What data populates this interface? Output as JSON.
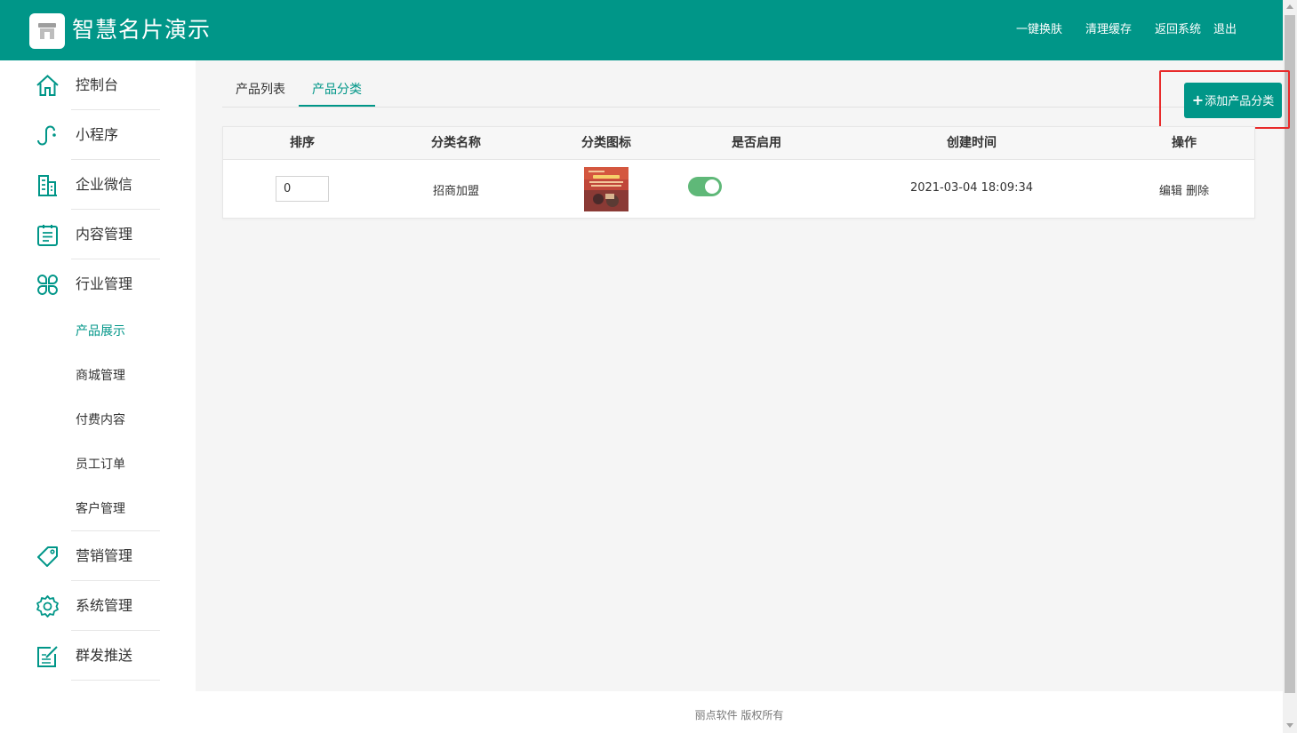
{
  "header": {
    "brand": "智慧名片演示",
    "nav": [
      "一键换肤",
      "清理缓存",
      "返回系统",
      "退出"
    ]
  },
  "sidebar": {
    "items": [
      {
        "label": "控制台",
        "icon": "home-icon"
      },
      {
        "label": "小程序",
        "icon": "mini-program-icon"
      },
      {
        "label": "企业微信",
        "icon": "building-icon"
      },
      {
        "label": "内容管理",
        "icon": "clipboard-icon"
      },
      {
        "label": "行业管理",
        "icon": "grid-icon"
      },
      {
        "label": "营销管理",
        "icon": "tag-icon"
      },
      {
        "label": "系统管理",
        "icon": "gear-icon"
      },
      {
        "label": "群发推送",
        "icon": "edit-icon"
      }
    ],
    "sub_items": [
      "产品展示",
      "商城管理",
      "付费内容",
      "员工订单",
      "客户管理"
    ],
    "active_sub": "产品展示"
  },
  "tabs": {
    "items": [
      "产品列表",
      "产品分类"
    ],
    "active": "产品分类"
  },
  "toolbar": {
    "add_label": "添加产品分类"
  },
  "table": {
    "headers": [
      "排序",
      "分类名称",
      "分类图标",
      "是否启用",
      "创建时间",
      "操作"
    ],
    "rows": [
      {
        "sort": "0",
        "name": "招商加盟",
        "enabled": true,
        "created": "2021-03-04 18:09:34",
        "edit": "编辑",
        "delete": "删除"
      }
    ]
  },
  "footer": {
    "text": "丽点软件 版权所有"
  },
  "colors": {
    "primary": "#009688",
    "switch_on": "#5fb878",
    "highlight": "#e82a2a"
  }
}
